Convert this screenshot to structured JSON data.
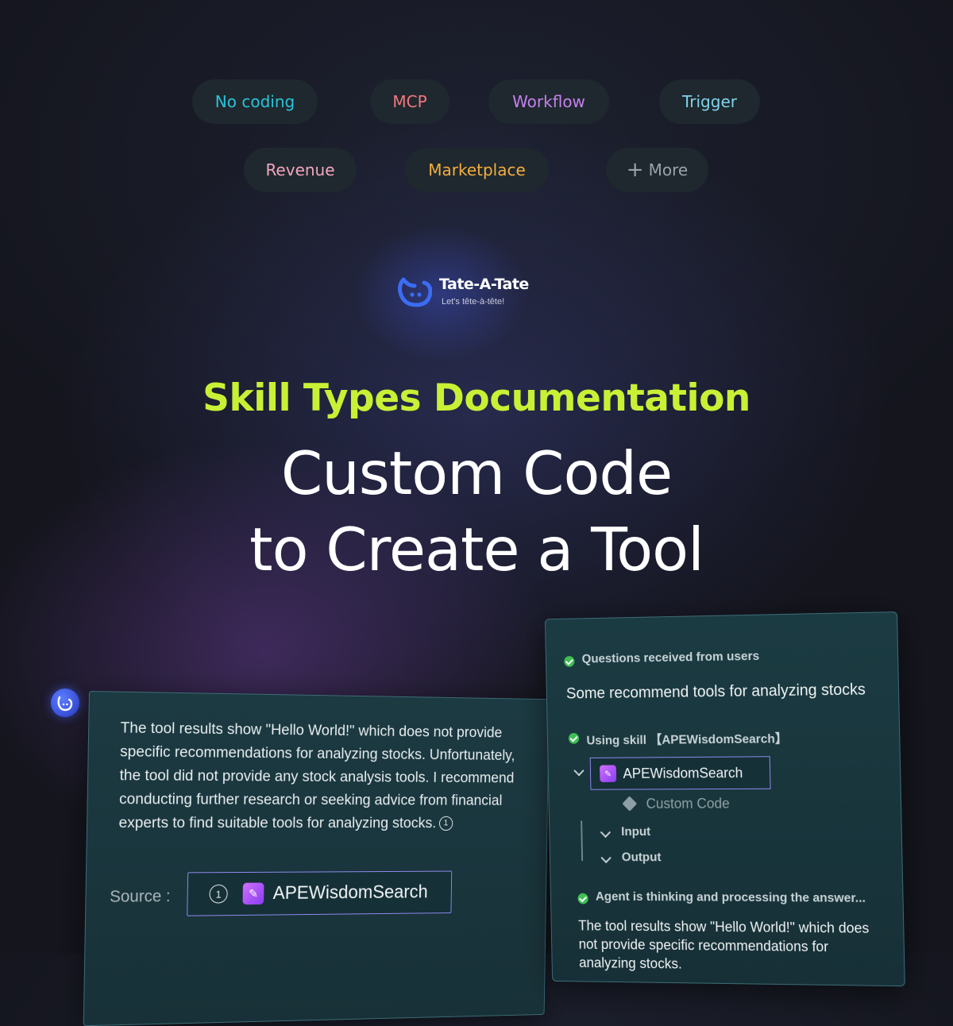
{
  "tags": [
    {
      "label": "No coding",
      "color": "#29c4d9"
    },
    {
      "label": "MCP",
      "color": "#f0787e"
    },
    {
      "label": "Workflow",
      "color": "#c680f0"
    },
    {
      "label": "Trigger",
      "color": "#7fd3ea"
    },
    {
      "label": "Revenue",
      "color": "#f2a6c0"
    },
    {
      "label": "Marketplace",
      "color": "#f4ae3e"
    },
    {
      "label": "More",
      "color": "#9aa3a8",
      "icon": "plus-icon"
    }
  ],
  "brand": {
    "name": "Tate-A-Tate",
    "tagline": "Let's tête-à-tête!"
  },
  "hero": {
    "subtitle": "Skill Types Documentation",
    "title_line1": "Custom Code",
    "title_line2": "to Create a Tool",
    "subtitle_color": "#c8f135"
  },
  "chat_card": {
    "message": "The tool results show \"Hello World!\" which does not provide specific recommendations for analyzing stocks. Unfortunately, the tool did not provide any stock analysis tools. I recommend conducting further research or seeking advice from financial experts to find suitable tools for analyzing stocks.",
    "citation": "1",
    "source_label": "Source :",
    "source_number": "1",
    "source_name": "APEWisdomSearch"
  },
  "process_card": {
    "step1_heading": "Questions received from users",
    "step1_text": "Some recommend tools for analyzing stocks",
    "step2_heading": "Using skill 【APEWisdomSearch】",
    "skill_name": "APEWisdomSearch",
    "skill_type": "Custom Code",
    "input_label": "Input",
    "output_label": "Output",
    "step3_heading": "Agent is thinking and processing the answer...",
    "step3_text": "The tool results show \"Hello World!\" which does not provide specific recommendations for analyzing stocks."
  }
}
